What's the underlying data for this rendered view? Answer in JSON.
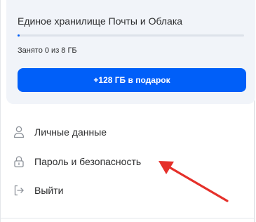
{
  "storage": {
    "title": "Единое хранилище Почты и Облака",
    "used_label": "Занято 0 из 8 ГБ",
    "used_fraction": 0,
    "gift_button_label": "+128 ГБ в подарок"
  },
  "menu": {
    "items": [
      {
        "label": "Личные данные",
        "icon": "person-icon"
      },
      {
        "label": "Пароль и безопасность",
        "icon": "lock-icon"
      },
      {
        "label": "Выйти",
        "icon": "logout-icon"
      }
    ]
  },
  "colors": {
    "accent": "#005ff9",
    "card_background": "#f1f4f9",
    "annotation_arrow": "#e5302a",
    "text": "#2c2d2e",
    "icon": "#8d929a"
  }
}
